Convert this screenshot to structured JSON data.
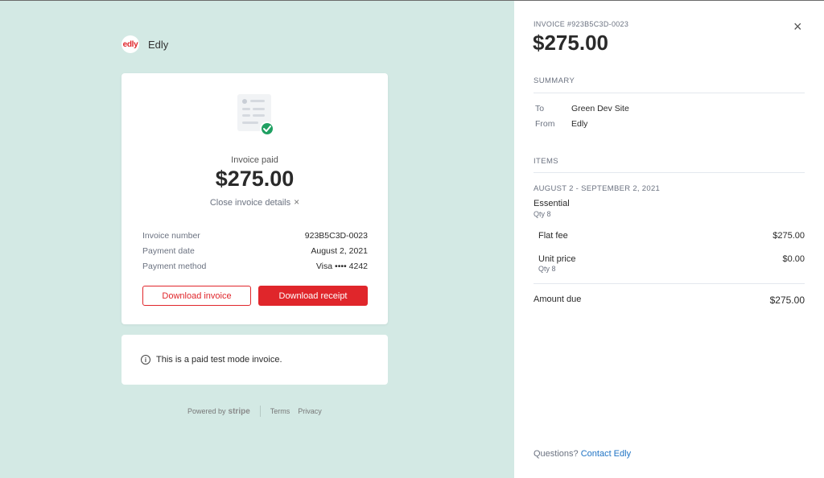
{
  "brand": {
    "logo_text": "edly",
    "name": "Edly"
  },
  "card": {
    "status_label": "Invoice paid",
    "amount": "$275.00",
    "close_details_label": "Close invoice details",
    "close_details_icon": "×",
    "details": [
      {
        "label": "Invoice number",
        "value": "923B5C3D-0023"
      },
      {
        "label": "Payment date",
        "value": "August 2, 2021"
      },
      {
        "label": "Payment method",
        "value": "Visa •••• 4242"
      }
    ],
    "download_invoice_label": "Download invoice",
    "download_receipt_label": "Download receipt"
  },
  "notice": {
    "icon": "i",
    "text": "This is a paid test mode invoice."
  },
  "footer": {
    "powered_by": "Powered by",
    "stripe": "stripe",
    "terms": "Terms",
    "privacy": "Privacy"
  },
  "panel": {
    "invoice_number": "INVOICE #923B5C3D-0023",
    "amount": "$275.00",
    "close_icon": "×",
    "summary_heading": "SUMMARY",
    "summary": [
      {
        "label": "To",
        "value": "Green Dev Site"
      },
      {
        "label": "From",
        "value": "Edly"
      }
    ],
    "items_heading": "ITEMS",
    "period": "AUGUST 2 - SEPTEMBER 2, 2021",
    "plan_name": "Essential",
    "plan_qty": "Qty 8",
    "lines": [
      {
        "label": "Flat fee",
        "qty": "",
        "value": "$275.00"
      },
      {
        "label": "Unit price",
        "qty": "Qty 8",
        "value": "$0.00"
      }
    ],
    "amount_due_label": "Amount due",
    "amount_due_value": "$275.00",
    "questions_label": "Questions?",
    "contact_label": "Contact Edly"
  },
  "colors": {
    "accent": "#e0262b",
    "background": "#d3e9e4",
    "link": "#1f73c4",
    "success": "#1fa062"
  }
}
